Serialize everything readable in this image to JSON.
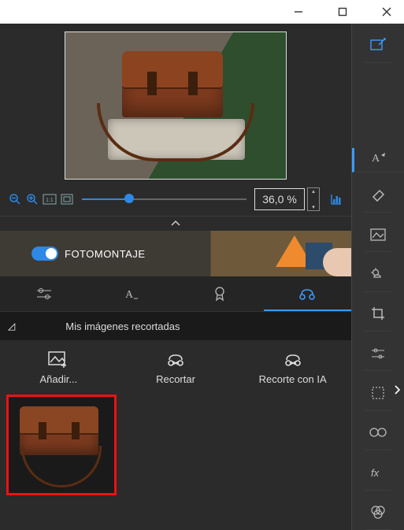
{
  "window": {
    "minimize": "—",
    "maximize": "▢",
    "close": "✕"
  },
  "zoom": {
    "value_text": "36,0 %"
  },
  "montage": {
    "toggle_label": "FOTOMONTAJE",
    "toggle_on": true
  },
  "section": {
    "title": "Mis imágenes recortadas"
  },
  "actions": {
    "add_label": "Añadir...",
    "crop_label": "Recortar",
    "ai_label": "Recorte con IA"
  },
  "sidebar_tools": {
    "compose": "compose",
    "text": "text",
    "erase": "erase",
    "background": "background",
    "sky": "sky",
    "crop": "crop",
    "adjust": "adjust",
    "select": "select",
    "glasses": "glasses",
    "fx": "fx",
    "color": "color"
  }
}
